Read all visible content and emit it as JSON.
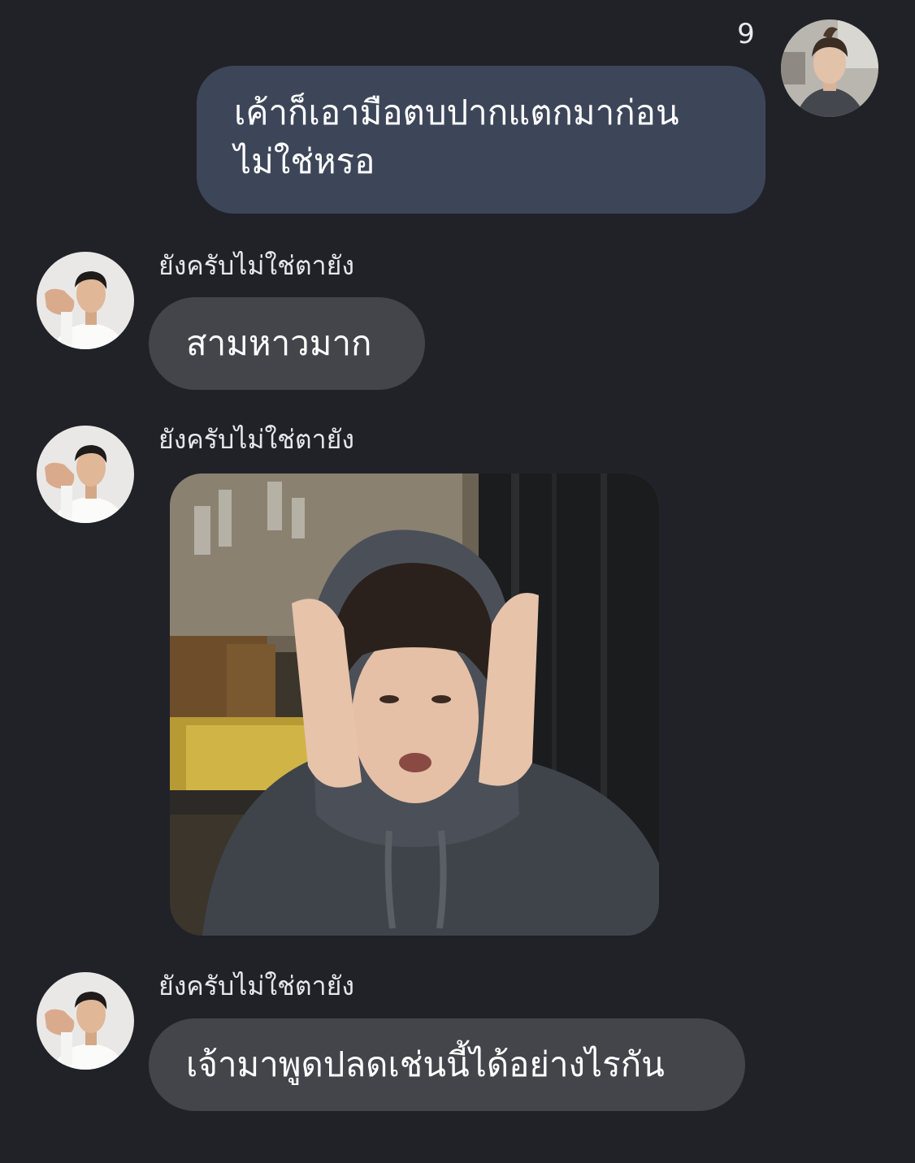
{
  "conversation": {
    "sent": {
      "read_count": "9",
      "lines": [
        "เค้าก็เอามือตบปากแตกมาก่อน",
        "ไม่ใช่หรอ"
      ]
    },
    "received": [
      {
        "sender": "ยังครับไม่ใช่ตายัง",
        "type": "text",
        "text": "สามหาวมาก"
      },
      {
        "sender": "ยังครับไม่ใช่ตายัง",
        "type": "image"
      },
      {
        "sender": "ยังครับไม่ใช่ตายัง",
        "type": "text",
        "text": "เจ้ามาพูดปลดเช่นนี้ได้อย่างไรกัน"
      }
    ]
  },
  "colors": {
    "background": "#212228",
    "sent_bubble": "#3d4659",
    "received_bubble": "#44454b"
  }
}
